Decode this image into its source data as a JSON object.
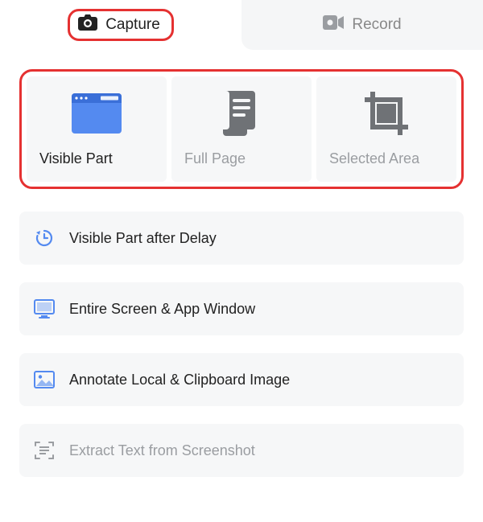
{
  "tabs": {
    "capture": "Capture",
    "record": "Record"
  },
  "tiles": {
    "visible": "Visible Part",
    "fullpage": "Full Page",
    "selected": "Selected Area"
  },
  "options": {
    "delay": "Visible Part after Delay",
    "entire": "Entire Screen & App Window",
    "annotate": "Annotate Local & Clipboard Image",
    "extract": "Extract Text from Screenshot"
  },
  "colors": {
    "highlight": "#e53131",
    "accent": "#548af0",
    "muted": "#9a9da1"
  }
}
